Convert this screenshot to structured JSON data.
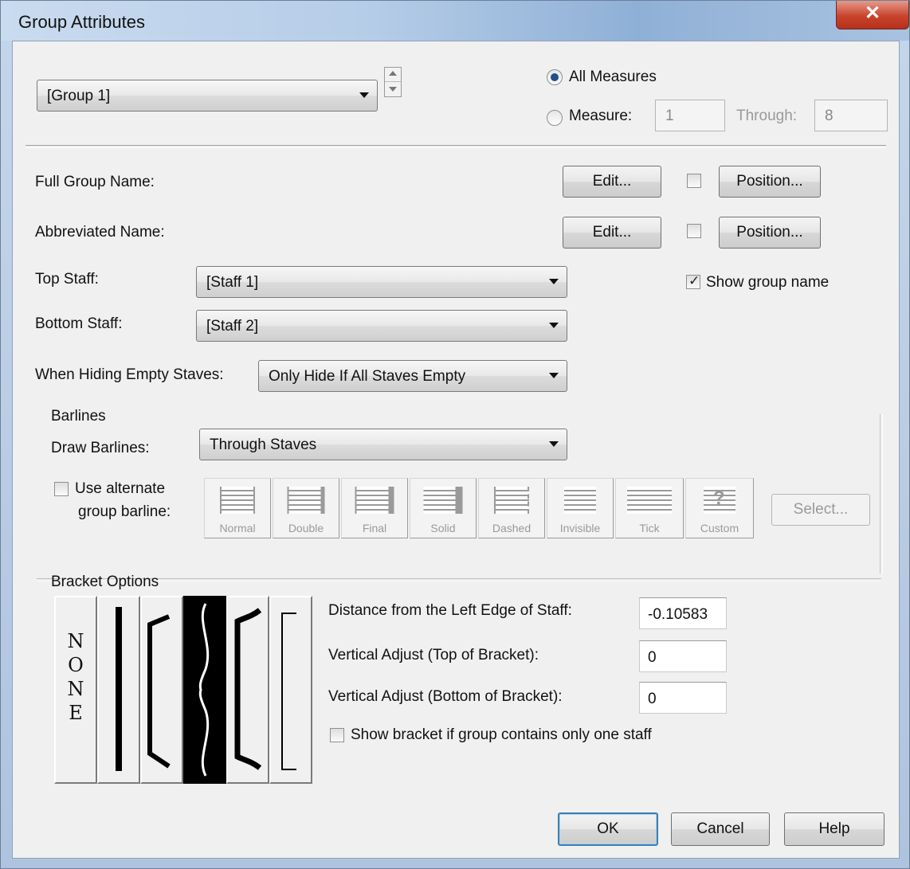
{
  "window": {
    "title": "Group Attributes",
    "close_glyph": "✕"
  },
  "group_select": {
    "value": "[Group 1]"
  },
  "measures": {
    "all_label": "All Measures",
    "measure_label": "Measure:",
    "from": "1",
    "through_label": "Through:",
    "to": "8",
    "selected": "all"
  },
  "names": {
    "full_label": "Full Group Name:",
    "abbr_label": "Abbreviated Name:",
    "edit_label": "Edit...",
    "position_label": "Position...",
    "full_checked": false,
    "abbr_checked": false
  },
  "staves": {
    "top_label": "Top Staff:",
    "top_value": "[Staff 1]",
    "bottom_label": "Bottom Staff:",
    "bottom_value": "[Staff 2]",
    "show_group_name_label": "Show group name",
    "show_group_name": true,
    "hide_label": "When Hiding Empty Staves:",
    "hide_value": "Only Hide If All Staves Empty"
  },
  "barlines": {
    "section_label": "Barlines",
    "draw_label": "Draw Barlines:",
    "draw_value": "Through Staves",
    "alt_label_1": "Use alternate",
    "alt_label_2": "group barline:",
    "alt_checked": false,
    "buttons": [
      "Normal",
      "Double",
      "Final",
      "Solid",
      "Dashed",
      "Invisible",
      "Tick",
      "Custom"
    ],
    "select_label": "Select..."
  },
  "brackets": {
    "section_label": "Bracket Options",
    "none_letters": [
      "N",
      "O",
      "N",
      "E"
    ],
    "options": [
      "none-bracket",
      "thick-line-bracket",
      "bracket",
      "piano-brace",
      "bracket-with-hooks",
      "thin-bracket"
    ],
    "selected_index": 3,
    "distance_label": "Distance from the Left Edge of Staff:",
    "distance_value": "-0.10583",
    "vtop_label": "Vertical Adjust (Top of Bracket):",
    "vtop_value": "0",
    "vbottom_label": "Vertical Adjust (Bottom of Bracket):",
    "vbottom_value": "0",
    "show_one_label": "Show bracket if group contains only one staff",
    "show_one_checked": false
  },
  "footer": {
    "ok": "OK",
    "cancel": "Cancel",
    "help": "Help"
  }
}
